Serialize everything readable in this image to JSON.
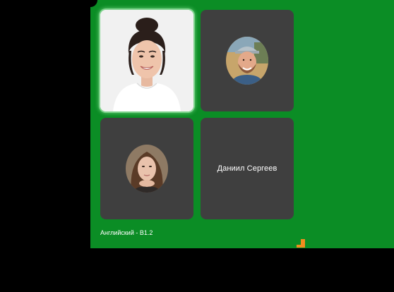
{
  "participants": [
    {
      "id": "teacher",
      "kind": "video",
      "active": true
    },
    {
      "id": "student-1",
      "kind": "avatar"
    },
    {
      "id": "student-2",
      "kind": "avatar"
    },
    {
      "id": "student-3",
      "kind": "name",
      "name": "Даниил Сергеев"
    }
  ],
  "course": {
    "label": "Английский - B1.2"
  },
  "colors": {
    "background": "#000000",
    "panel": "#0b8d25",
    "tile": "#3f3f3f",
    "accent": "#f28c1e"
  }
}
